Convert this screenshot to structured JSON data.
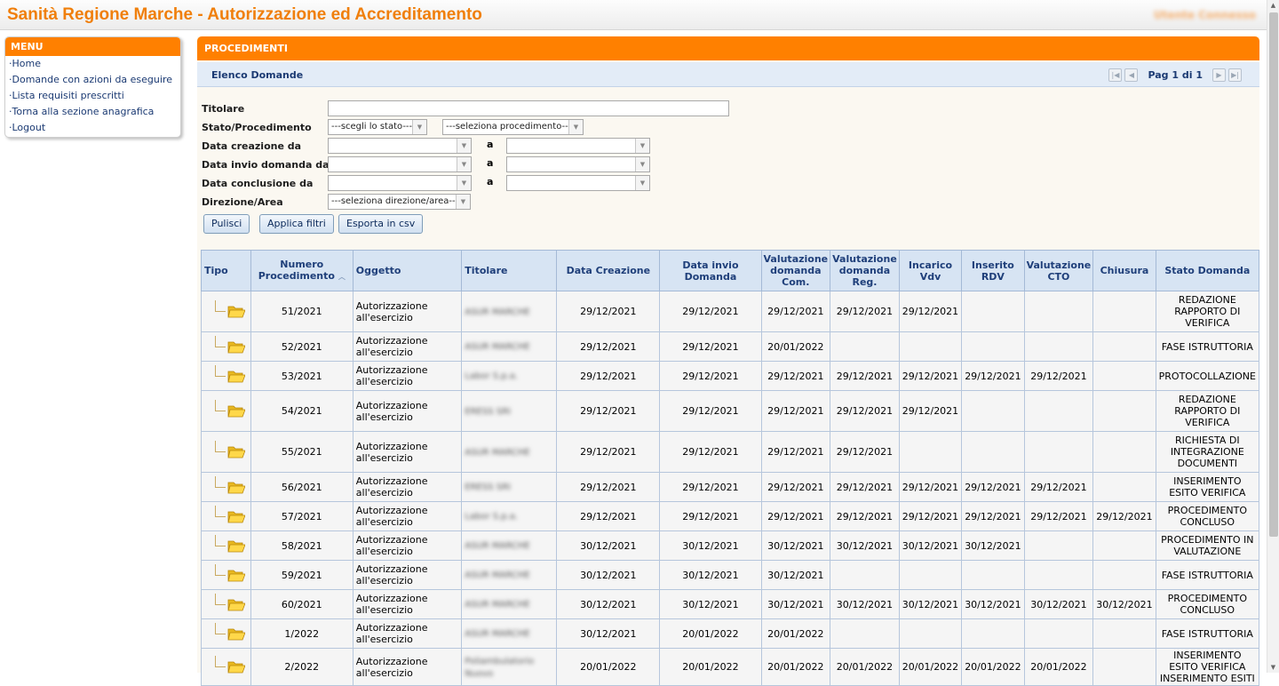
{
  "app_title": "Sanità Regione Marche - Autorizzazione ed Accreditamento",
  "user_name": "Utente Connesso",
  "menu": {
    "title": "MENU",
    "items": [
      {
        "label": "Home"
      },
      {
        "label": "Domande con azioni da eseguire"
      },
      {
        "label": "Lista requisiti prescritti"
      },
      {
        "label": "Torna alla sezione anagrafica"
      },
      {
        "label": "Logout"
      }
    ]
  },
  "panel": {
    "title": "PROCEDIMENTI",
    "subtitle": "Elenco Domande",
    "page_label": "Pag 1 di 1"
  },
  "filters": {
    "titolare_label": "Titolare",
    "titolare_value": "",
    "stato_label": "Stato/Procedimento",
    "stato_select": "---scegli lo stato---",
    "procedimento_select": "---seleziona procedimento---",
    "creazione_label": "Data creazione da",
    "invio_label": "Data invio domanda da",
    "conclusione_label": "Data conclusione da",
    "a_label": "a",
    "direzione_label": "Direzione/Area",
    "direzione_select": "---seleziona direzione/area---",
    "btn_pulisci": "Pulisci",
    "btn_applica": "Applica filtri",
    "btn_esporta": "Esporta in csv"
  },
  "table": {
    "headers": {
      "tipo": "Tipo",
      "numero": "Numero Procedimento",
      "oggetto": "Oggetto",
      "titolare": "Titolare",
      "data_creazione": "Data Creazione",
      "data_invio": "Data invio Domanda",
      "val_com": "Valutazione domanda Com.",
      "val_reg": "Valutazione domanda Reg.",
      "incarico": "Incarico Vdv",
      "rdv": "Inserito RDV",
      "cto": "Valutazione CTO",
      "chiusura": "Chiusura",
      "stato": "Stato Domanda"
    },
    "rows": [
      {
        "numero": "51/2021",
        "oggetto": "Autorizzazione all'esercizio",
        "titolare": "ASUR MARCHE",
        "creazione": "29/12/2021",
        "invio": "29/12/2021",
        "com": "29/12/2021",
        "reg": "29/12/2021",
        "vdv": "29/12/2021",
        "rdv": "",
        "cto": "",
        "chiusura": "",
        "stato": "REDAZIONE RAPPORTO DI VERIFICA"
      },
      {
        "numero": "52/2021",
        "oggetto": "Autorizzazione all'esercizio",
        "titolare": "ASUR MARCHE",
        "creazione": "29/12/2021",
        "invio": "29/12/2021",
        "com": "20/01/2022",
        "reg": "",
        "vdv": "",
        "rdv": "",
        "cto": "",
        "chiusura": "",
        "stato": "FASE ISTRUTTORIA"
      },
      {
        "numero": "53/2021",
        "oggetto": "Autorizzazione all'esercizio",
        "titolare": "Labor S.p.a.",
        "creazione": "29/12/2021",
        "invio": "29/12/2021",
        "com": "29/12/2021",
        "reg": "29/12/2021",
        "vdv": "29/12/2021",
        "rdv": "29/12/2021",
        "cto": "29/12/2021",
        "chiusura": "",
        "stato": "PROTOCOLLAZIONE"
      },
      {
        "numero": "54/2021",
        "oggetto": "Autorizzazione all'esercizio",
        "titolare": "ERESS SRI",
        "creazione": "29/12/2021",
        "invio": "29/12/2021",
        "com": "29/12/2021",
        "reg": "29/12/2021",
        "vdv": "29/12/2021",
        "rdv": "",
        "cto": "",
        "chiusura": "",
        "stato": "REDAZIONE RAPPORTO DI VERIFICA"
      },
      {
        "numero": "55/2021",
        "oggetto": "Autorizzazione all'esercizio",
        "titolare": "ASUR MARCHE",
        "creazione": "29/12/2021",
        "invio": "29/12/2021",
        "com": "29/12/2021",
        "reg": "29/12/2021",
        "vdv": "",
        "rdv": "",
        "cto": "",
        "chiusura": "",
        "stato": "RICHIESTA DI INTEGRAZIONE DOCUMENTI"
      },
      {
        "numero": "56/2021",
        "oggetto": "Autorizzazione all'esercizio",
        "titolare": "ERESS SRI",
        "creazione": "29/12/2021",
        "invio": "29/12/2021",
        "com": "29/12/2021",
        "reg": "29/12/2021",
        "vdv": "29/12/2021",
        "rdv": "29/12/2021",
        "cto": "29/12/2021",
        "chiusura": "",
        "stato": "INSERIMENTO ESITO VERIFICA"
      },
      {
        "numero": "57/2021",
        "oggetto": "Autorizzazione all'esercizio",
        "titolare": "Labor S.p.a.",
        "creazione": "29/12/2021",
        "invio": "29/12/2021",
        "com": "29/12/2021",
        "reg": "29/12/2021",
        "vdv": "29/12/2021",
        "rdv": "29/12/2021",
        "cto": "29/12/2021",
        "chiusura": "29/12/2021",
        "stato": "PROCEDIMENTO CONCLUSO"
      },
      {
        "numero": "58/2021",
        "oggetto": "Autorizzazione all'esercizio",
        "titolare": "ASUR MARCHE",
        "creazione": "30/12/2021",
        "invio": "30/12/2021",
        "com": "30/12/2021",
        "reg": "30/12/2021",
        "vdv": "30/12/2021",
        "rdv": "30/12/2021",
        "cto": "",
        "chiusura": "",
        "stato": "PROCEDIMENTO IN VALUTAZIONE"
      },
      {
        "numero": "59/2021",
        "oggetto": "Autorizzazione all'esercizio",
        "titolare": "ASUR MARCHE",
        "creazione": "30/12/2021",
        "invio": "30/12/2021",
        "com": "30/12/2021",
        "reg": "",
        "vdv": "",
        "rdv": "",
        "cto": "",
        "chiusura": "",
        "stato": "FASE ISTRUTTORIA"
      },
      {
        "numero": "60/2021",
        "oggetto": "Autorizzazione all'esercizio",
        "titolare": "ASUR MARCHE",
        "creazione": "30/12/2021",
        "invio": "30/12/2021",
        "com": "30/12/2021",
        "reg": "30/12/2021",
        "vdv": "30/12/2021",
        "rdv": "30/12/2021",
        "cto": "30/12/2021",
        "chiusura": "30/12/2021",
        "stato": "PROCEDIMENTO CONCLUSO"
      },
      {
        "numero": "1/2022",
        "oggetto": "Autorizzazione all'esercizio",
        "titolare": "ASUR MARCHE",
        "creazione": "30/12/2021",
        "invio": "20/01/2022",
        "com": "20/01/2022",
        "reg": "",
        "vdv": "",
        "rdv": "",
        "cto": "",
        "chiusura": "",
        "stato": "FASE ISTRUTTORIA"
      },
      {
        "numero": "2/2022",
        "oggetto": "Autorizzazione all'esercizio",
        "titolare": "Poliambulatorio Nuovo",
        "creazione": "20/01/2022",
        "invio": "20/01/2022",
        "com": "20/01/2022",
        "reg": "20/01/2022",
        "vdv": "20/01/2022",
        "rdv": "20/01/2022",
        "cto": "20/01/2022",
        "chiusura": "",
        "stato": "INSERIMENTO ESITO VERIFICA INSERIMENTO ESITI"
      }
    ]
  }
}
